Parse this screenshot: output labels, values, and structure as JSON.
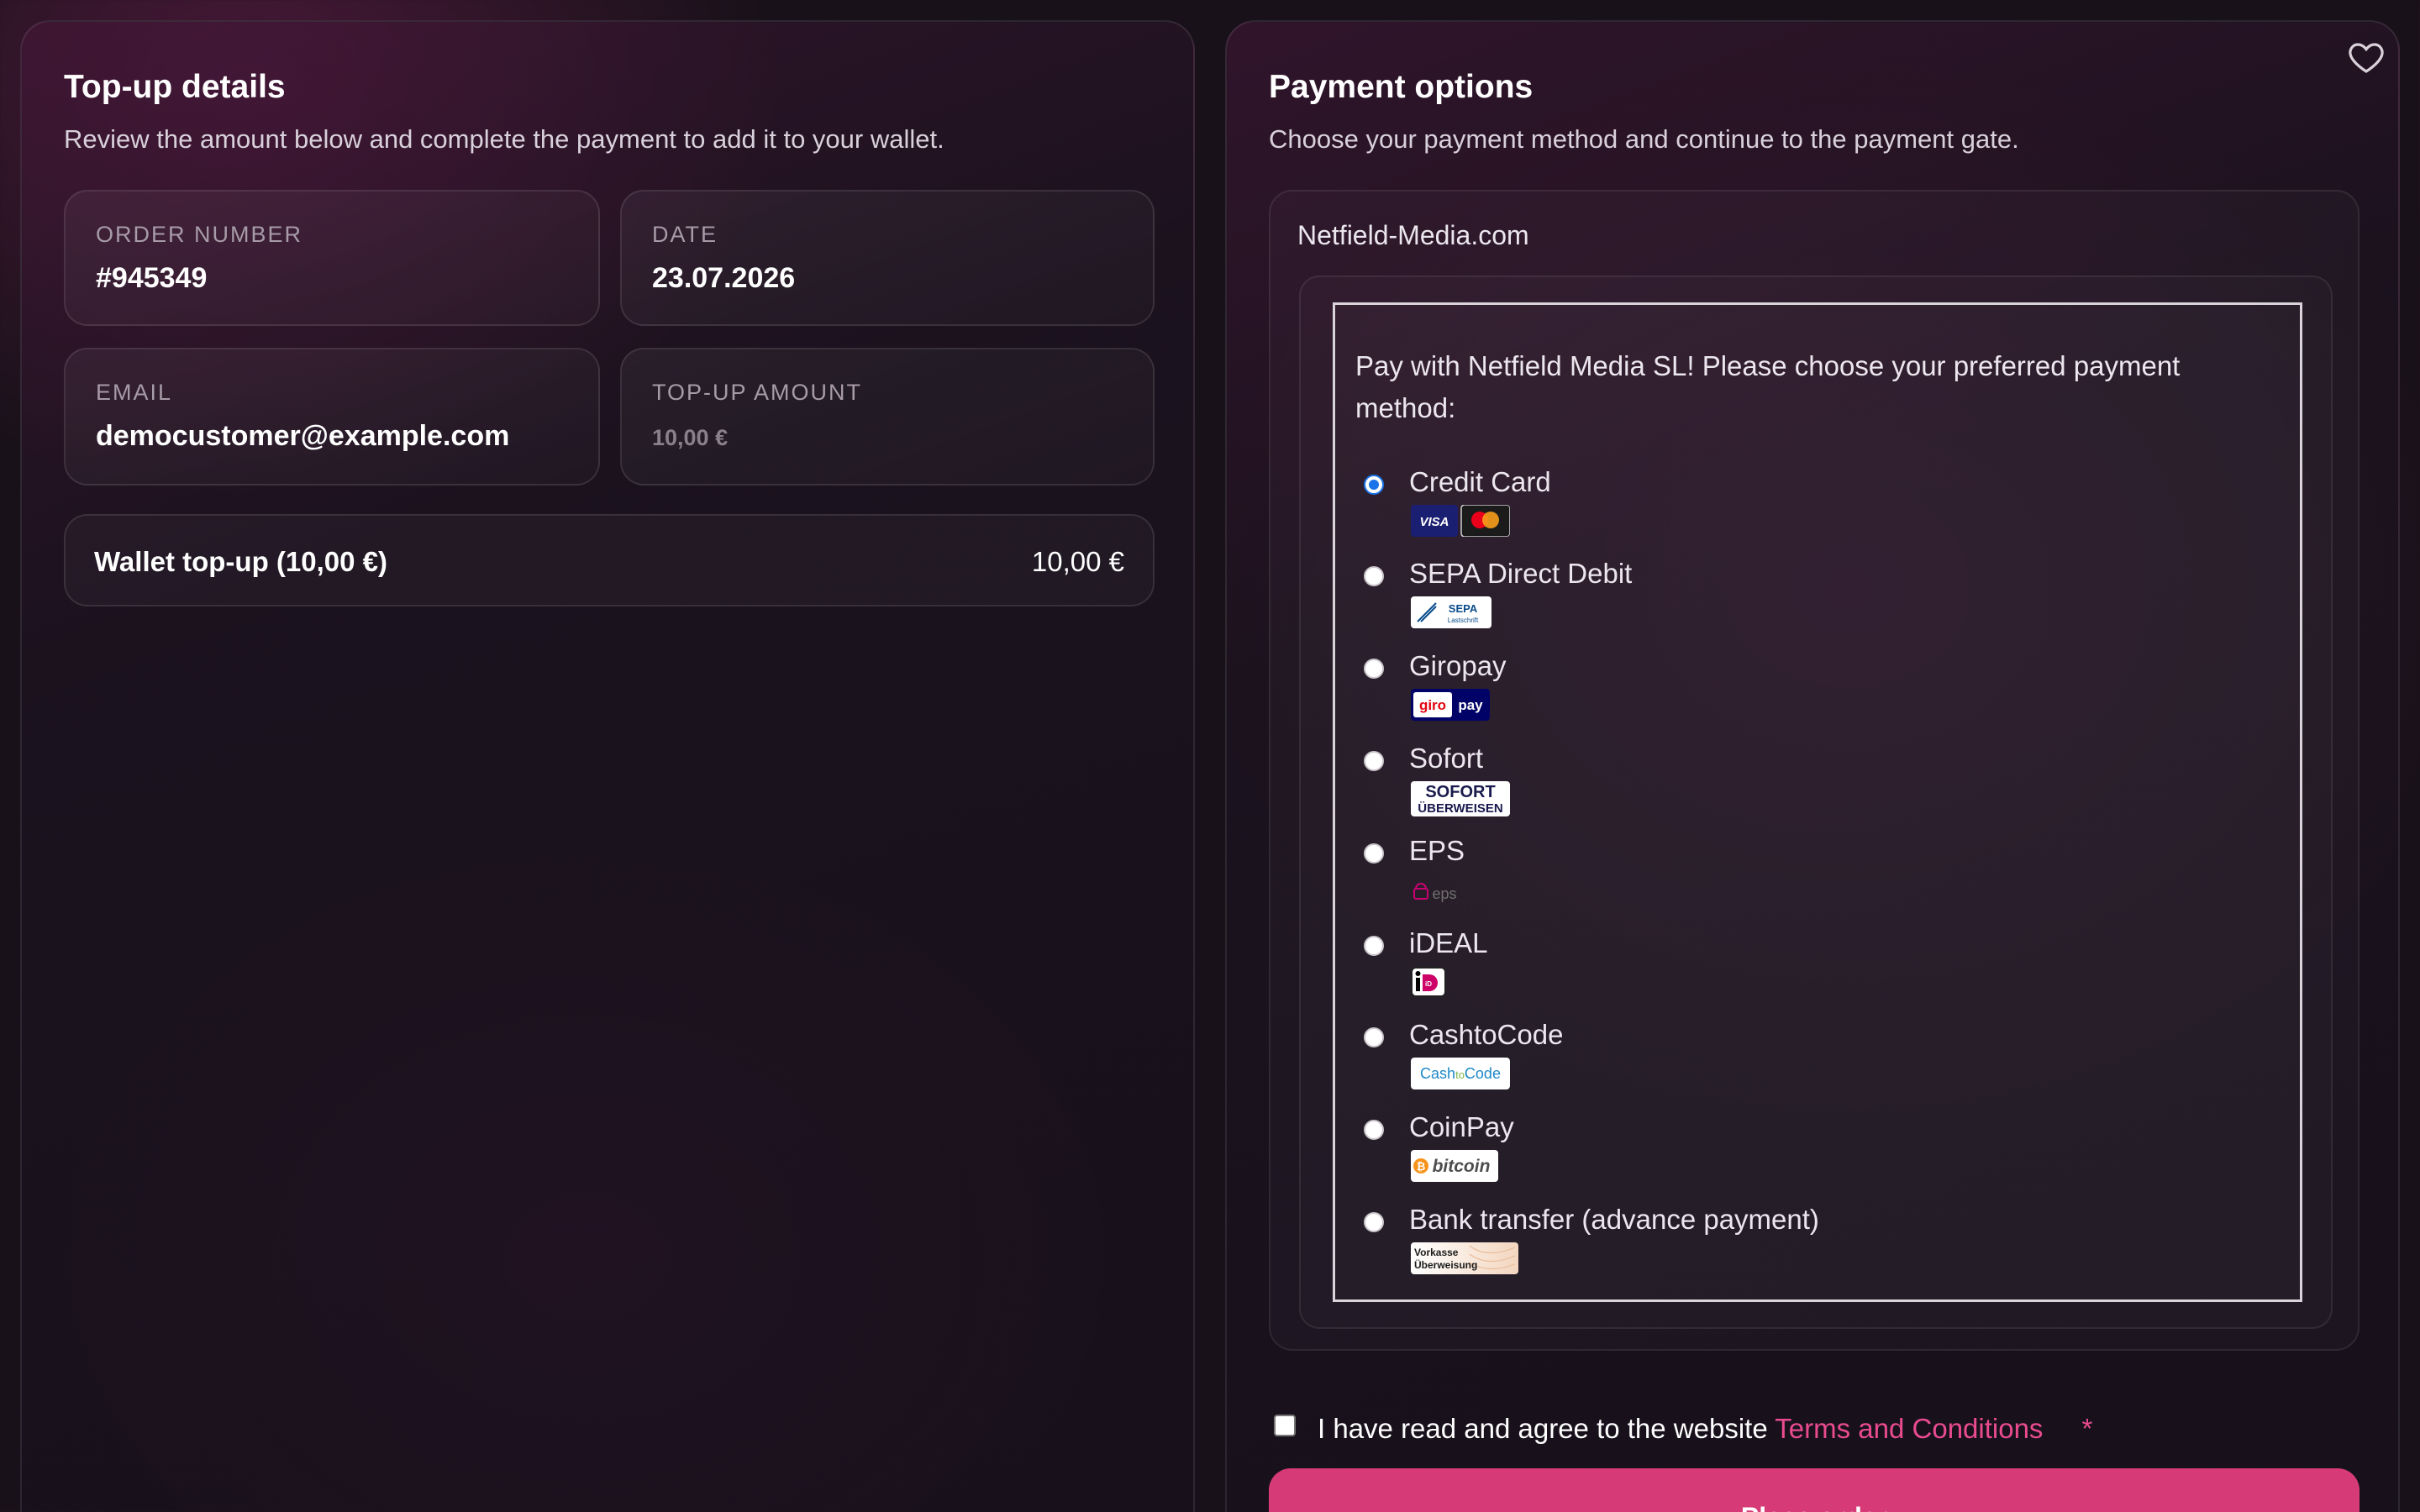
{
  "topup": {
    "title": "Top-up details",
    "subtitle": "Review the amount below and complete the payment to add it to your wallet.",
    "order_number_label": "ORDER NUMBER",
    "order_number": "#945349",
    "date_label": "DATE",
    "date": "23.07.2026",
    "email_label": "EMAIL",
    "email": "democustomer@example.com",
    "amount_label": "TOP-UP AMOUNT",
    "amount": "10,00 €",
    "line_item_name": "Wallet top-up (10,00 €)",
    "line_item_price": "10,00 €"
  },
  "payment": {
    "title": "Payment options",
    "subtitle": "Choose your payment method and continue to the payment gate.",
    "gateway_name": "Netfield-Media.com",
    "intro": "Pay with Netfield Media SL! Please choose your preferred payment method:",
    "methods": [
      {
        "label": "Credit Card",
        "selected": true,
        "icon": "visa-mastercard-icon"
      },
      {
        "label": "SEPA Direct Debit",
        "selected": false,
        "icon": "sepa-lastschrift-icon"
      },
      {
        "label": "Giropay",
        "selected": false,
        "icon": "giropay-icon"
      },
      {
        "label": "Sofort",
        "selected": false,
        "icon": "sofort-ueberweisen-icon"
      },
      {
        "label": "EPS",
        "selected": false,
        "icon": "eps-icon"
      },
      {
        "label": "iDEAL",
        "selected": false,
        "icon": "ideal-icon"
      },
      {
        "label": "CashtoCode",
        "selected": false,
        "icon": "cashtocode-icon"
      },
      {
        "label": "CoinPay",
        "selected": false,
        "icon": "bitcoin-icon"
      },
      {
        "label": "Bank transfer (advance payment)",
        "selected": false,
        "icon": "vorkasse-ueberweisung-icon"
      }
    ],
    "logo_text": {
      "visa": "VISA",
      "sepa": "SEPA",
      "sepa_sub": "Lastschrift",
      "giro": "giro",
      "pay": "pay",
      "sofort": "SOFORT",
      "sofort_sub": "ÜBERWEISEN",
      "eps": "eps",
      "ideal": "iD",
      "cash": "Cash",
      "to": "to",
      "code": "Code",
      "bitcoin": "bitcoin",
      "vorkasse_1": "Vorkasse",
      "vorkasse_2": "Überweisung"
    },
    "terms_prefix": "I have read and agree to the website",
    "terms_link": "Terms and Conditions",
    "terms_required": "*",
    "place_order": "Place order"
  },
  "colors": {
    "accent": "#d63a77",
    "link": "#e94b8f",
    "radio_selected": "#1a73e8"
  }
}
